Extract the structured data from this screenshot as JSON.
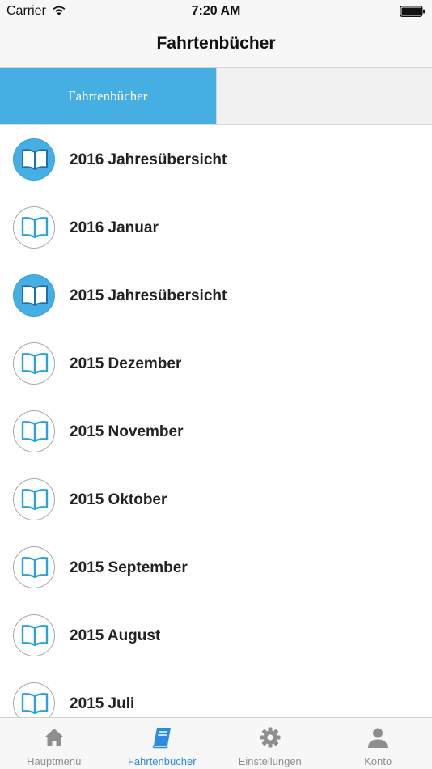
{
  "status_bar": {
    "carrier": "Carrier",
    "time": "7:20 AM"
  },
  "nav": {
    "title": "Fahrtenbücher"
  },
  "segments": [
    {
      "label": "Fahrtenbücher",
      "selected": true
    },
    {
      "label": "",
      "selected": false
    }
  ],
  "list": {
    "items": [
      {
        "label": "2016 Jahresübersicht",
        "style": "filled"
      },
      {
        "label": "2016 Januar",
        "style": "outline"
      },
      {
        "label": "2015 Jahresübersicht",
        "style": "filled"
      },
      {
        "label": "2015 Dezember",
        "style": "outline"
      },
      {
        "label": "2015 November",
        "style": "outline"
      },
      {
        "label": "2015 Oktober",
        "style": "outline"
      },
      {
        "label": "2015 September",
        "style": "outline"
      },
      {
        "label": "2015 August",
        "style": "outline"
      },
      {
        "label": "2015 Juli",
        "style": "outline"
      }
    ],
    "icon": "open-book-icon"
  },
  "tab_bar": {
    "tabs": [
      {
        "label": "Hauptmenü",
        "icon": "home-icon",
        "selected": false
      },
      {
        "label": "Fahrtenbücher",
        "icon": "book-icon",
        "selected": true
      },
      {
        "label": "Einstellungen",
        "icon": "gear-icon",
        "selected": false
      },
      {
        "label": "Konto",
        "icon": "person-icon",
        "selected": false
      }
    ]
  },
  "colors": {
    "accent": "#45aee3",
    "tab_selected": "#2b8be0",
    "tab_unselected": "#8e8e8e",
    "icon_gray": "#8e8e8e"
  }
}
